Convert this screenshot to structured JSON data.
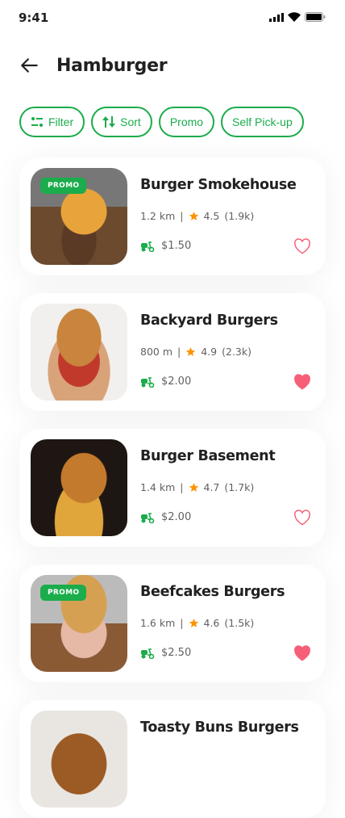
{
  "status": {
    "time": "9:41"
  },
  "header": {
    "title": "Hamburger",
    "back_icon": "arrow-left-icon"
  },
  "chips": [
    {
      "label": "Filter",
      "icon": "sliders-icon"
    },
    {
      "label": "Sort",
      "icon": "sort-icon"
    },
    {
      "label": "Promo"
    },
    {
      "label": "Self Pick-up"
    }
  ],
  "colors": {
    "accent": "#1bac4b",
    "rating": "#fb9400",
    "heart": "#f75e78"
  },
  "restaurants": [
    {
      "name": "Burger Smokehouse",
      "distance": "1.2 km",
      "rating": "4.5",
      "reviews": "(1.9k)",
      "fee": "$1.50",
      "promo": "PROMO",
      "favorite": false
    },
    {
      "name": "Backyard Burgers",
      "distance": "800 m",
      "rating": "4.9",
      "reviews": "(2.3k)",
      "fee": "$2.00",
      "favorite": true
    },
    {
      "name": "Burger Basement",
      "distance": "1.4 km",
      "rating": "4.7",
      "reviews": "(1.7k)",
      "fee": "$2.00",
      "favorite": false
    },
    {
      "name": "Beefcakes Burgers",
      "distance": "1.6 km",
      "rating": "4.6",
      "reviews": "(1.5k)",
      "fee": "$2.50",
      "promo": "PROMO",
      "favorite": true
    },
    {
      "name": "Toasty Buns Burgers"
    }
  ]
}
